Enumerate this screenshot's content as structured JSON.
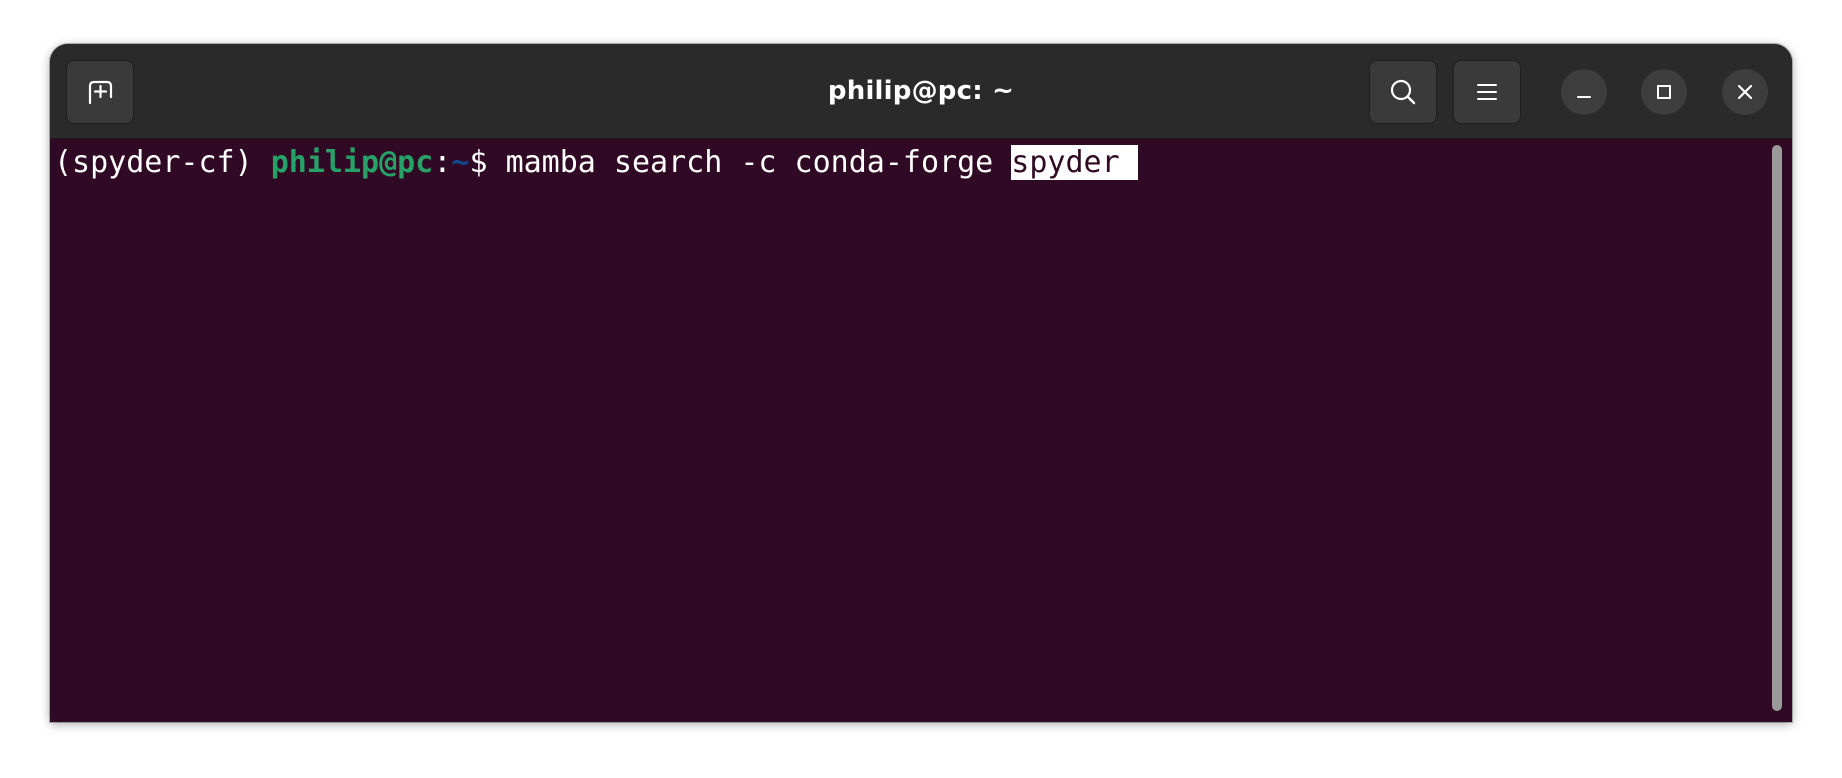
{
  "window": {
    "title": "philip@pc: ~"
  },
  "icons": {
    "new_tab": "new-tab-icon",
    "search": "search-icon",
    "menu": "hamburger-menu-icon",
    "minimize": "minimize-icon",
    "maximize": "maximize-icon",
    "close": "close-icon"
  },
  "terminal": {
    "env": "(spyder-cf) ",
    "user_host": "philip@pc",
    "colon": ":",
    "cwd": "~",
    "prompt_symbol": "$ ",
    "command_text": "mamba search -c conda-forge ",
    "selected_text": "spyder ",
    "colors": {
      "background": "#300a24",
      "user_host": "#26a269",
      "cwd": "#12488b",
      "text": "#ffffff"
    }
  }
}
